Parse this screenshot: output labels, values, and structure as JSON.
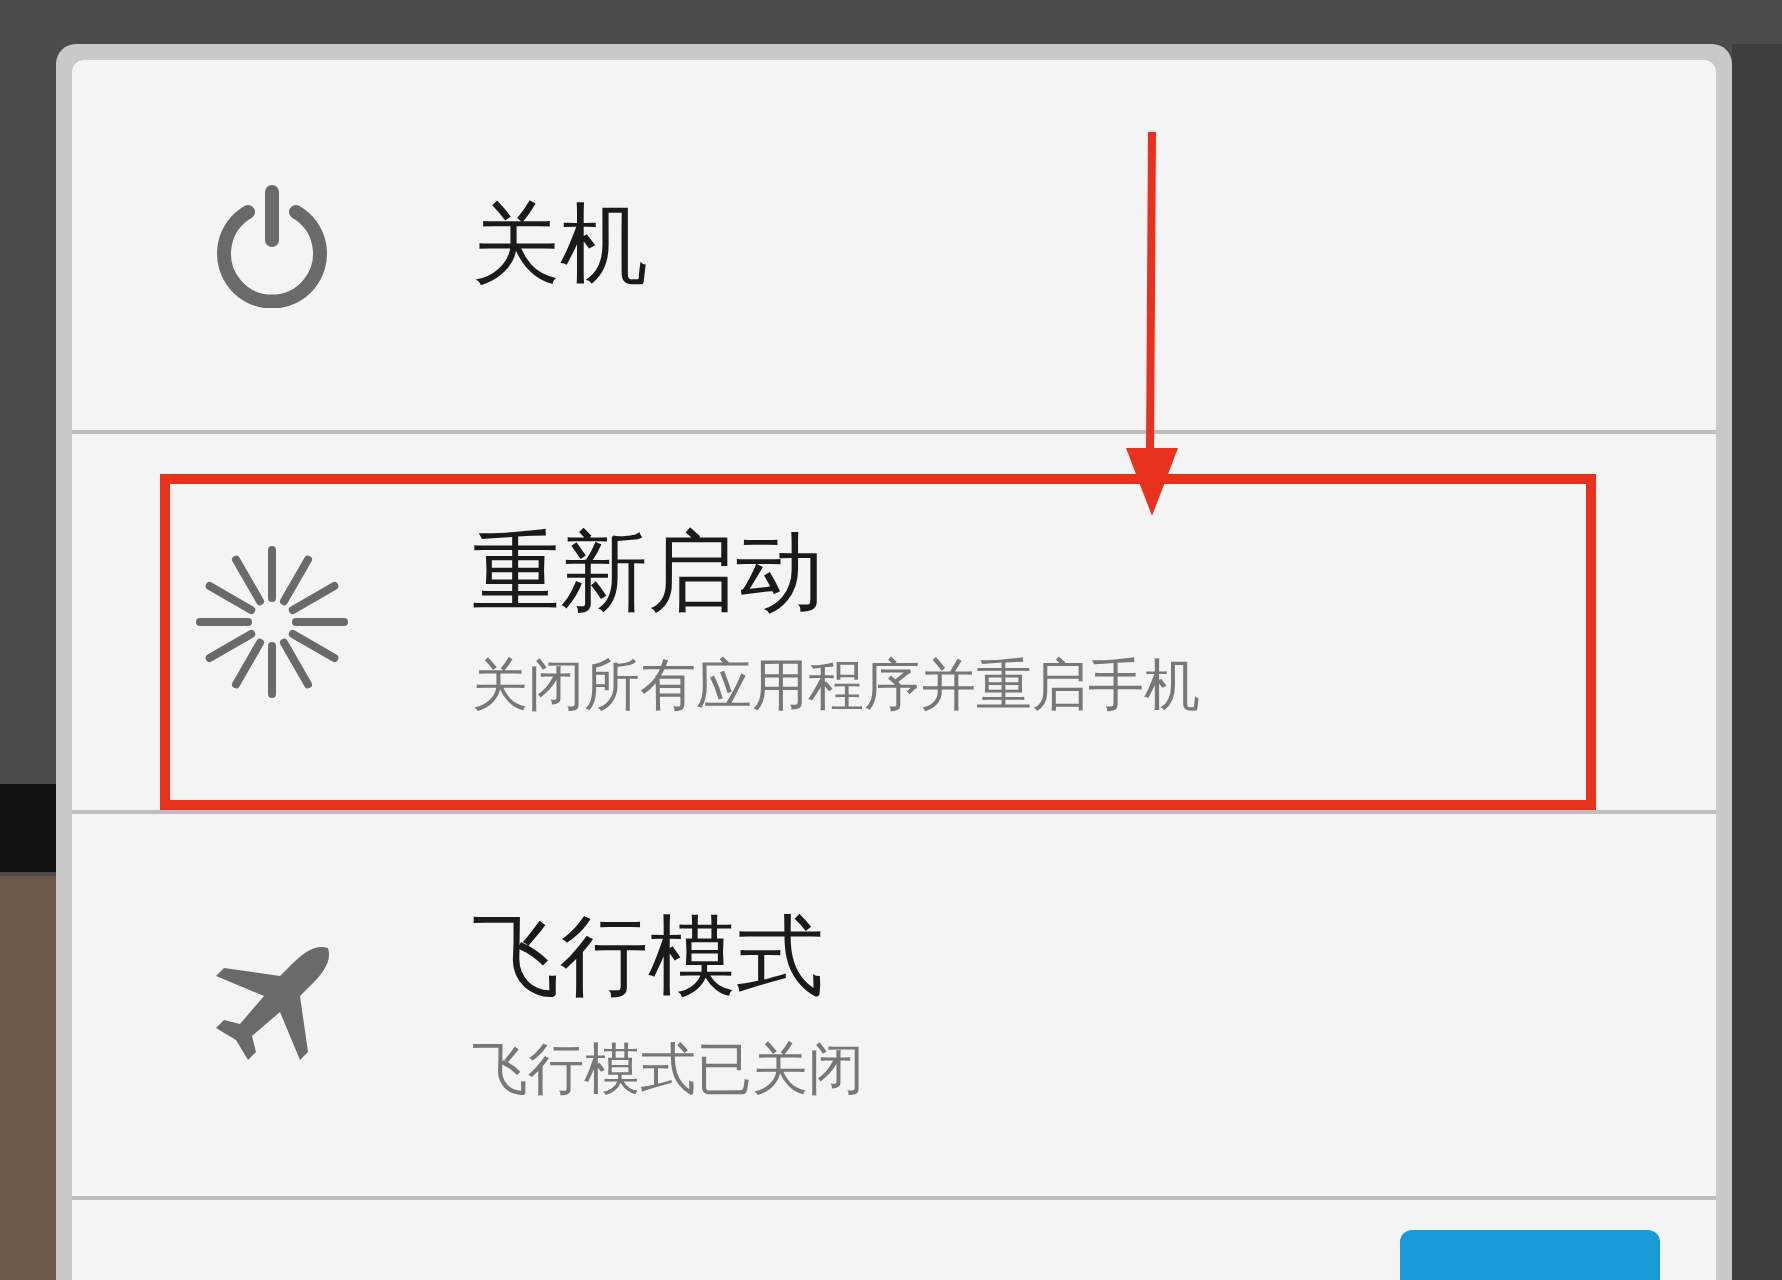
{
  "menu_items": [
    {
      "kind": "power",
      "title": "关机",
      "highlighted": false
    },
    {
      "kind": "restart",
      "title": "重新启动",
      "subtitle": "关闭所有应用程序并重启手机",
      "highlighted": true
    },
    {
      "kind": "airplane",
      "title": "飞行模式",
      "subtitle": "飞行模式已关闭",
      "highlighted": false
    }
  ]
}
